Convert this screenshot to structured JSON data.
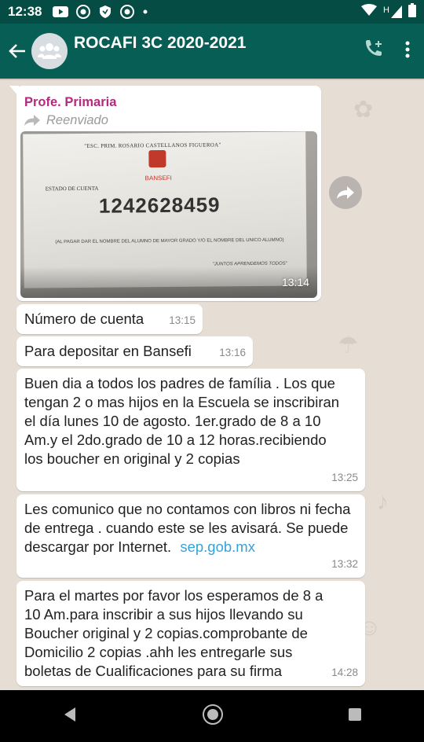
{
  "status_bar": {
    "time": "12:38",
    "icons": [
      "youtube-icon",
      "chrome-icon",
      "shield-app-icon",
      "chrome-icon",
      "dot-icon"
    ],
    "right_icons": [
      "wifi-icon",
      "signal-h-icon",
      "battery-icon"
    ],
    "network_letter": "H"
  },
  "app_bar": {
    "title": "ROCAFI 3C 2020-2021",
    "background": "#075e54",
    "actions": [
      "add-call-icon",
      "more-options-icon"
    ]
  },
  "chat": {
    "background": "#e6ddd4",
    "messages": [
      {
        "sender": "Profe. Primaria",
        "forwarded_label": "Reenviado",
        "photo": {
          "header": "\"ESC. PRIM. ROSARIO CASTELLANOS FIGUEROA\"",
          "logo_text": "BANSEFI",
          "label": "ESTADO DE CUENTA",
          "account_number": "1242628459",
          "note": "(AL PAGAR DAR EL NOMBRE DEL ALUMNO DE MAYOR GRADO Y/O EL NOMBRE DEL UNICO ALUMNO)",
          "motto": "\"JUNTOS APRENDEMOS TODOS\""
        },
        "time": "13:14"
      },
      {
        "text": "Número de cuenta",
        "time": "13:15"
      },
      {
        "text": "Para depositar en Bansefi",
        "time": "13:16"
      },
      {
        "text": "Buen dia a todos los padres de família . Los que tengan 2 o mas hijos en la Escuela se inscribiran el día lunes 10 de agosto. 1er.grado de 8 a 10 Am.y el 2do.grado de 10 a 12 horas.recibiendo los boucher en original y 2 copias",
        "time": "13:25"
      },
      {
        "text": "Les comunico que no contamos con libros ni fecha de entrega . cuando este se les avisará. Se puede descargar por Internet.",
        "link": "sep.gob.mx",
        "time": "13:32"
      },
      {
        "text": "Para el martes por favor los esperamos de 8 a 10 Am.para inscribir a sus hijos llevando su Boucher original y 2 copias.comprobante de Domicilio 2 copias .ahh les entregarle sus boletas de Cualificaciones para su firma",
        "time": "14:28"
      }
    ]
  },
  "nav_bar": {
    "buttons": [
      "back-nav-icon",
      "home-nav-icon",
      "recents-nav-icon"
    ]
  }
}
